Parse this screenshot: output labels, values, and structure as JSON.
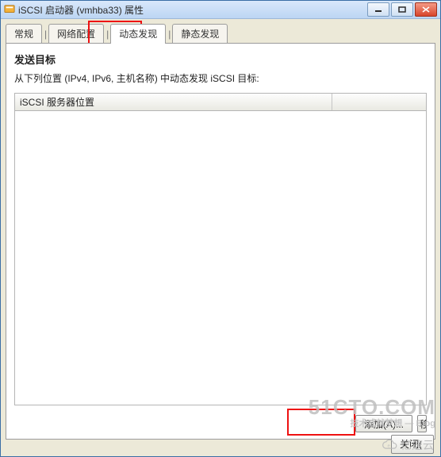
{
  "window": {
    "title": "iSCSI 启动器 (vmhba33) 属性"
  },
  "tabs": {
    "t0": "常规",
    "t1": "网络配置",
    "t2": "动态发现",
    "t3": "静态发现"
  },
  "section": {
    "title": "发送目标",
    "desc": "从下列位置 (IPv4, IPv6, 主机名称) 中动态发现 iSCSI 目标:"
  },
  "grid": {
    "col1": "iSCSI 服务器位置"
  },
  "buttons": {
    "add": "添加(A)...",
    "remove_fragment": "移",
    "close_fragment": "关闭("
  },
  "watermark": {
    "main": "51CTO.COM",
    "sub": "技术成就梦想 — Blog",
    "yisu": "亿速云"
  }
}
